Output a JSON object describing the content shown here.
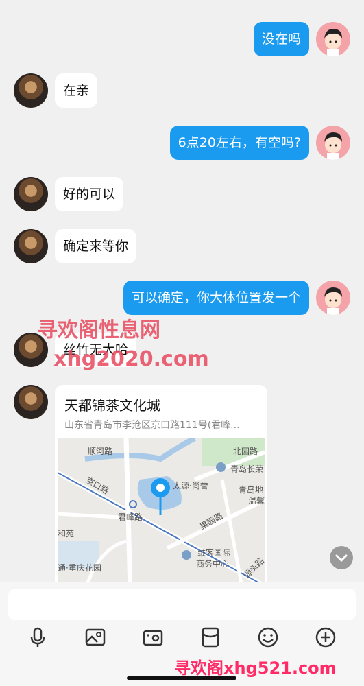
{
  "messages": [
    {
      "from": "me",
      "text": "没在吗"
    },
    {
      "from": "her",
      "text": "在亲"
    },
    {
      "from": "me",
      "text": "6点20左右，有空吗?"
    },
    {
      "from": "her",
      "text": "好的可以"
    },
    {
      "from": "her",
      "text": "确定来等你"
    },
    {
      "from": "me",
      "text": "可以确定，你大体位置发一个"
    },
    {
      "from": "her",
      "text": "丝竹无大哈"
    }
  ],
  "location": {
    "title": "天都锦茶文化城",
    "address": "山东省青岛市李沧区京口路111号(君峰...",
    "map_labels": {
      "shunhe": "顺河路",
      "beiyuan": "北园路",
      "qingdaochang": "青岛长荣",
      "jingkou": "京口路",
      "taiyuan": "太源·尚誉",
      "qingdaodi": "青岛地",
      "wenxin": "温馨",
      "junfeng": "君峰路",
      "guoyuan": "果园路",
      "hehe": "和苑",
      "weike": "维客国际",
      "shangwu": "商务中心",
      "chongqing": "通·重庆花园",
      "yuantou": "源头路"
    }
  },
  "watermarks": {
    "top": "寻欢阁性息网",
    "mid": "xhg2020.com",
    "bottom": "寻欢阁xhg521.com"
  },
  "composer": {
    "placeholder": ""
  },
  "colors": {
    "my_bubble": "#1a9bf0",
    "her_bubble": "#ffffff",
    "background": "#f0f0f0"
  },
  "icons": [
    "microphone-icon",
    "photo-icon",
    "camera-icon",
    "red-packet-icon",
    "emoji-icon",
    "plus-icon"
  ]
}
